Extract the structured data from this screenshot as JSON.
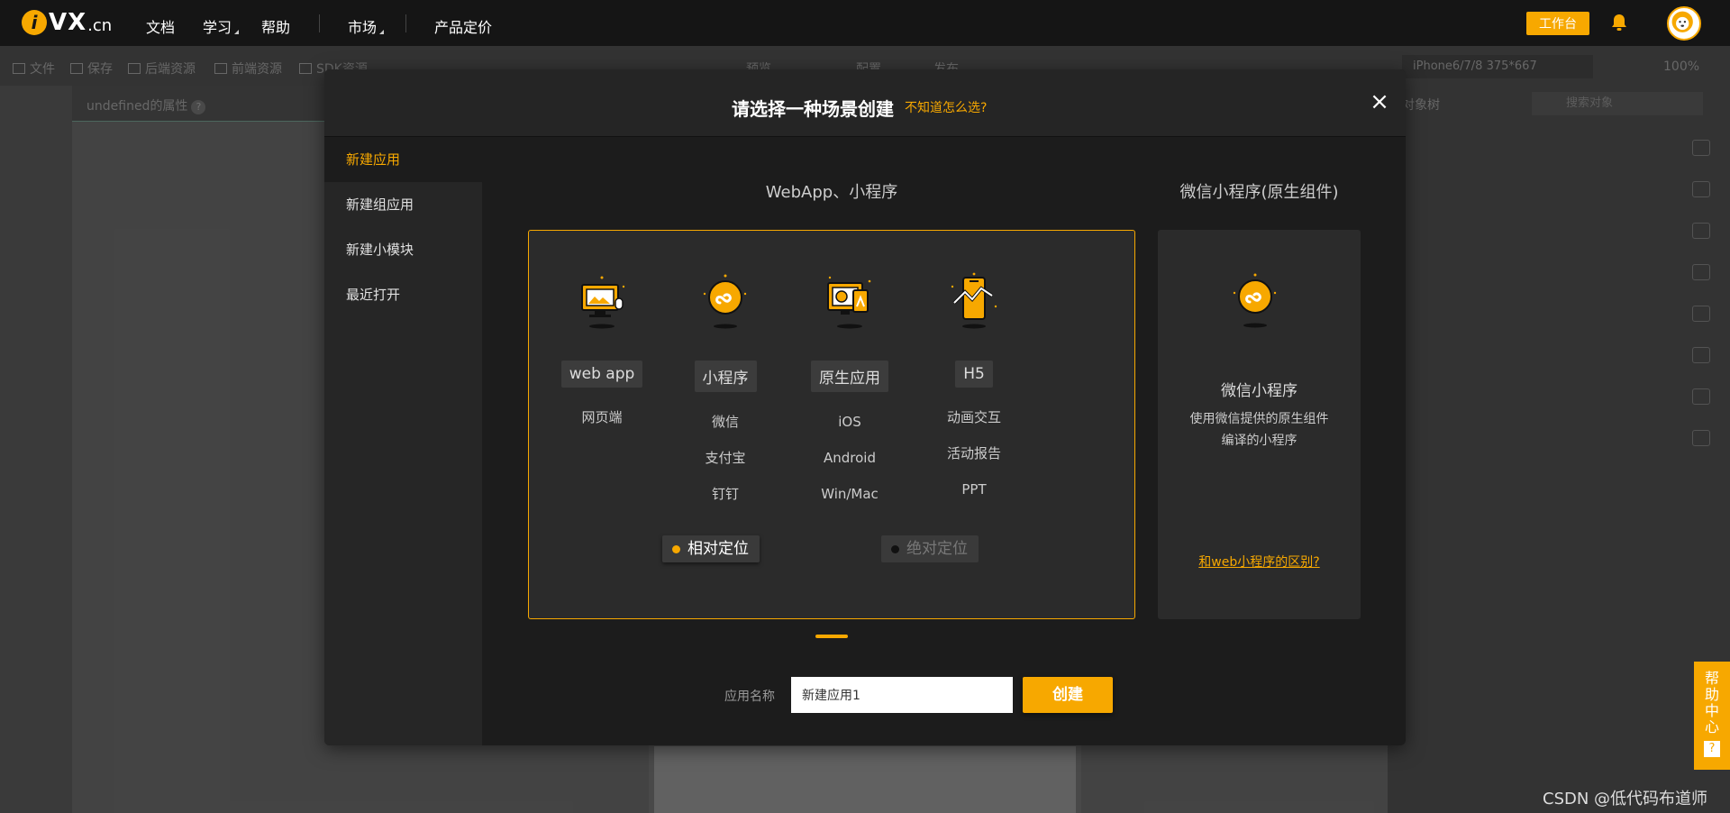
{
  "topnav": {
    "logo": {
      "mark": "i",
      "brand": "VX",
      "suffix": ".cn"
    },
    "items": [
      {
        "label": "文档"
      },
      {
        "label": "学习"
      },
      {
        "label": "帮助"
      },
      {
        "label": "市场"
      },
      {
        "label": "产品定价"
      }
    ],
    "workbench_label": "工作台",
    "bell_icon": "bell-icon",
    "avatar_icon": "lion-avatar"
  },
  "toolbar": {
    "items": [
      "文件",
      "保存",
      "后端资源",
      "前端资源",
      "SDK资源",
      "预览",
      "配置",
      "发布"
    ],
    "device": "iPhone6/7/8 375*667",
    "zoom": "100%"
  },
  "props_panel": {
    "title": "undefined的属性",
    "help": "?"
  },
  "object_tree": {
    "title": "对象树",
    "search_placeholder": "搜索对象"
  },
  "modal": {
    "title": "请选择一种场景创建",
    "help_link": "不知道怎么选?",
    "close": "×",
    "sidebar": [
      {
        "label": "新建应用",
        "active": true
      },
      {
        "label": "新建组应用",
        "active": false
      },
      {
        "label": "新建小模块",
        "active": false
      },
      {
        "label": "最近打开",
        "active": false
      }
    ],
    "sections": {
      "main": "WebApp、小程序",
      "wechat": "微信小程序(原生组件)"
    },
    "platforms": [
      {
        "icon": "web-app-monitor-icon",
        "label": "web app",
        "subs": [
          "网页端"
        ]
      },
      {
        "icon": "mini-program-icon",
        "label": "小程序",
        "subs": [
          "微信",
          "支付宝",
          "钉钉"
        ]
      },
      {
        "icon": "native-app-devices-icon",
        "label": "原生应用",
        "subs": [
          "iOS",
          "Android",
          "Win/Mac"
        ]
      },
      {
        "icon": "h5-phone-chart-icon",
        "label": "H5",
        "subs": [
          "动画交互",
          "活动报告",
          "PPT"
        ]
      }
    ],
    "positioning": [
      {
        "label": "相对定位",
        "selected": true
      },
      {
        "label": "绝对定位",
        "selected": false
      }
    ],
    "wechat": {
      "icon": "mini-program-icon",
      "title": "微信小程序",
      "desc": "使用微信提供的原生组件编译的小程序",
      "link": "和web小程序的区别?"
    },
    "app_name_label": "应用名称",
    "app_name_value": "新建应用1",
    "create_label": "创建"
  },
  "help_center": {
    "label": "帮助中心",
    "q": "?"
  },
  "watermark": "CSDN @低代码布道师",
  "colors": {
    "accent": "#f7a800",
    "modal_bg": "#1c1c1c",
    "card_bg": "#2b2b2b"
  }
}
